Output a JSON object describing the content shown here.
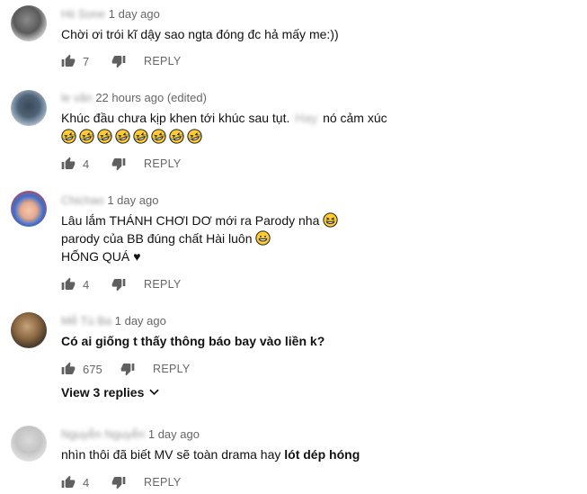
{
  "comments": [
    {
      "author": "Hii Sone",
      "time": "1 day ago",
      "lines": [
        "Chời ơi trói kĩ dậy sao ngta đóng đc hả mấy me:))"
      ],
      "likes": "7",
      "reply": "REPLY"
    },
    {
      "author": "le văn",
      "time": "22 hours ago (edited)",
      "line1_before": "Khúc đầu chưa kịp khen tới khúc sau tụt.",
      "line1_blur": "Hay",
      "line1_after": "nó cảm xúc",
      "emoji_count": 8,
      "likes": "4",
      "reply": "REPLY"
    },
    {
      "author": "Chichao",
      "time": "1 day ago",
      "lines": [
        "Lâu lắm THÁNH CHƠI DƠ mới ra Parody nha",
        "parody của BB đúng chất Hài luôn",
        "HỐNG QUÁ"
      ],
      "likes": "4",
      "reply": "REPLY"
    },
    {
      "author": "Mễ Tú Ba",
      "time": "1 day ago",
      "lines": [
        "Có ai giống t thấy thông báo bay vào liền k?"
      ],
      "likes": "675",
      "reply": "REPLY",
      "view_replies": "View 3 replies"
    },
    {
      "author": "Nguyễn Nguyễn",
      "time": "1 day ago",
      "line1_before": "nhìn thôi đã biết MV sẽ toàn drama hay",
      "line1_bold": "lót dép hóng",
      "likes": "4",
      "reply": "REPLY"
    }
  ]
}
